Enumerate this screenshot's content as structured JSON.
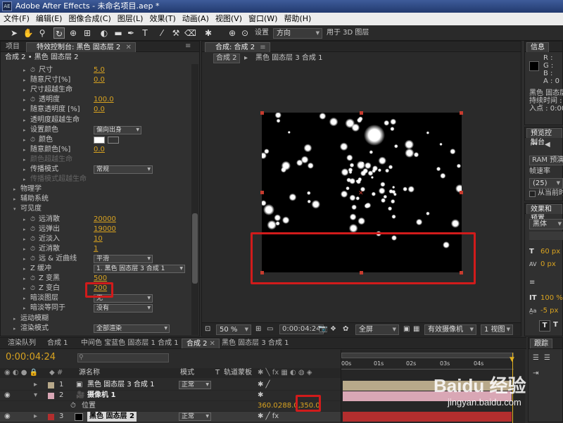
{
  "window": {
    "title": "Adobe After Effects - 未命名项目.aep *",
    "app_icon": "AE"
  },
  "menu": [
    "文件(F)",
    "编辑(E)",
    "图像合成(C)",
    "图层(L)",
    "效果(T)",
    "动画(A)",
    "视图(V)",
    "窗口(W)",
    "帮助(H)"
  ],
  "toolbar": {
    "settings_label": "设置",
    "settings_value": "方向",
    "use3d_label": "用于 3D 图层"
  },
  "effects_panel": {
    "tab_project": "项目",
    "tab_effects": "特效控制台: 黑色 固态层 2",
    "breadcrumb": "合成 2 • 黑色 固态层 2",
    "rows": [
      {
        "label": "尺寸",
        "value": "5.0",
        "stopwatch": true,
        "indent": 2
      },
      {
        "label": "随意尺寸[%]",
        "value": "0.0",
        "indent": 2
      },
      {
        "label": "尺寸超越生命",
        "value": "",
        "indent": 2,
        "expand": true
      },
      {
        "label": "透明度",
        "value": "100.0",
        "stopwatch": true,
        "indent": 2
      },
      {
        "label": "随意透明度 [%]",
        "value": "0.0",
        "indent": 2
      },
      {
        "label": "透明度超越生命",
        "value": "",
        "indent": 2,
        "expand": true
      },
      {
        "label": "设置颜色",
        "value": "",
        "indent": 2,
        "dropdown": "偏向出身"
      },
      {
        "label": "颜色",
        "value": "",
        "stopwatch": true,
        "indent": 2,
        "color": true
      },
      {
        "label": "随意颜色[%]",
        "value": "0.0",
        "indent": 2
      },
      {
        "label": "颜色超越生命",
        "value": "",
        "indent": 2,
        "disabled": true
      },
      {
        "label": "传播模式",
        "value": "",
        "indent": 2,
        "dropdown": "常规"
      },
      {
        "label": "传播模式超越生命",
        "value": "",
        "indent": 2,
        "disabled": true
      },
      {
        "label": "物理学",
        "value": "",
        "indent": 1,
        "expand": true
      },
      {
        "label": "辅助系统",
        "value": "",
        "indent": 1,
        "expand": true
      },
      {
        "label": "可见度",
        "value": "",
        "indent": 1,
        "expanded": true
      },
      {
        "label": "远消散",
        "value": "20000",
        "stopwatch": true,
        "indent": 2
      },
      {
        "label": "远弹出",
        "value": "19000",
        "stopwatch": true,
        "indent": 2
      },
      {
        "label": "近淡入",
        "value": "10",
        "stopwatch": true,
        "indent": 2
      },
      {
        "label": "近消散",
        "value": "1",
        "stopwatch": true,
        "indent": 2
      },
      {
        "label": "远 & 近曲线",
        "value": "",
        "stopwatch": true,
        "indent": 2,
        "dropdown": "平滑"
      },
      {
        "label": "Z 缓冲",
        "value": "",
        "indent": 2,
        "dropdown": "1. 黑色 固态层 3 合成 1"
      },
      {
        "label": "Z 变黑",
        "value": "500",
        "stopwatch": true,
        "indent": 2
      },
      {
        "label": "Z 变白",
        "value": "200",
        "stopwatch": true,
        "indent": 2
      },
      {
        "label": "暗淡图层",
        "value": "",
        "indent": 2,
        "dropdown": "无"
      },
      {
        "label": "暗淡等同于",
        "value": "",
        "indent": 2,
        "dropdown": "没有"
      },
      {
        "label": "运动模糊",
        "value": "",
        "indent": 1,
        "expand": true
      },
      {
        "label": "渲染模式",
        "value": "",
        "indent": 1,
        "dropdown": "全部渲染"
      }
    ]
  },
  "comp_panel": {
    "tab": "合成: 合成 2",
    "breadcrumbs": [
      "合成 2",
      "黑色 固态层 3 合成 1"
    ],
    "zoom": "50 %",
    "timecode": "0:00:04:24",
    "resolution": "全屏",
    "camera": "有效摄像机",
    "views": "1 视图"
  },
  "info_panel": {
    "tab": "信息",
    "r": "R :",
    "g": "G :",
    "b": "B :",
    "a": "A : 0",
    "layer_name": "黑色 固态层",
    "duration_label": "持续时间 :",
    "in_label": "入点 : 0:00"
  },
  "preview_panel": {
    "tab": "预览控制台",
    "ram_label": "RAM 预演",
    "framerate_label": "帧速率",
    "framerate_value": "(25)",
    "from_current": "从当前时"
  },
  "char_panel": {
    "tab": "效果和预置",
    "font": "黑体",
    "size": "60 px",
    "tracking": "0 px",
    "vscale": "100 %",
    "baseline": "-5 px"
  },
  "bottom_tabs": [
    "渲染队列",
    "合成 1",
    "中间色 宝蓝色 固态层 1 合成 1",
    "合成 2",
    "黑色 固态层 3 合成 1"
  ],
  "tracker_tab": "跟踪",
  "timeline": {
    "timecode": "0:00:04:24",
    "col_source": "源名称",
    "col_mode": "模式",
    "col_t": "T",
    "col_trkmat": "轨道蒙板",
    "ruler": [
      "00s",
      "01s",
      "02s",
      "03s",
      "04s"
    ],
    "layers": [
      {
        "num": "1",
        "name": "黑色 固态层 3 合成 1",
        "mode": "正常",
        "color": "#b8a98a"
      },
      {
        "num": "2",
        "name": "摄像机 1",
        "mode": "",
        "color": "#d9a7b5"
      },
      {
        "num": "3",
        "name": "黑色 固态层 2",
        "mode": "正常",
        "color": "#b32e2e"
      }
    ],
    "position_label": "位置",
    "position_x": "360.0,",
    "position_y": "288.0,",
    "position_z": "350.0"
  },
  "watermark": {
    "brand": "Baidu 经验",
    "url": "jingyan.baidu.com"
  },
  "colors": {
    "accent": "#d9a320",
    "highlight_box": "#d11b1b",
    "panel": "#303030"
  }
}
